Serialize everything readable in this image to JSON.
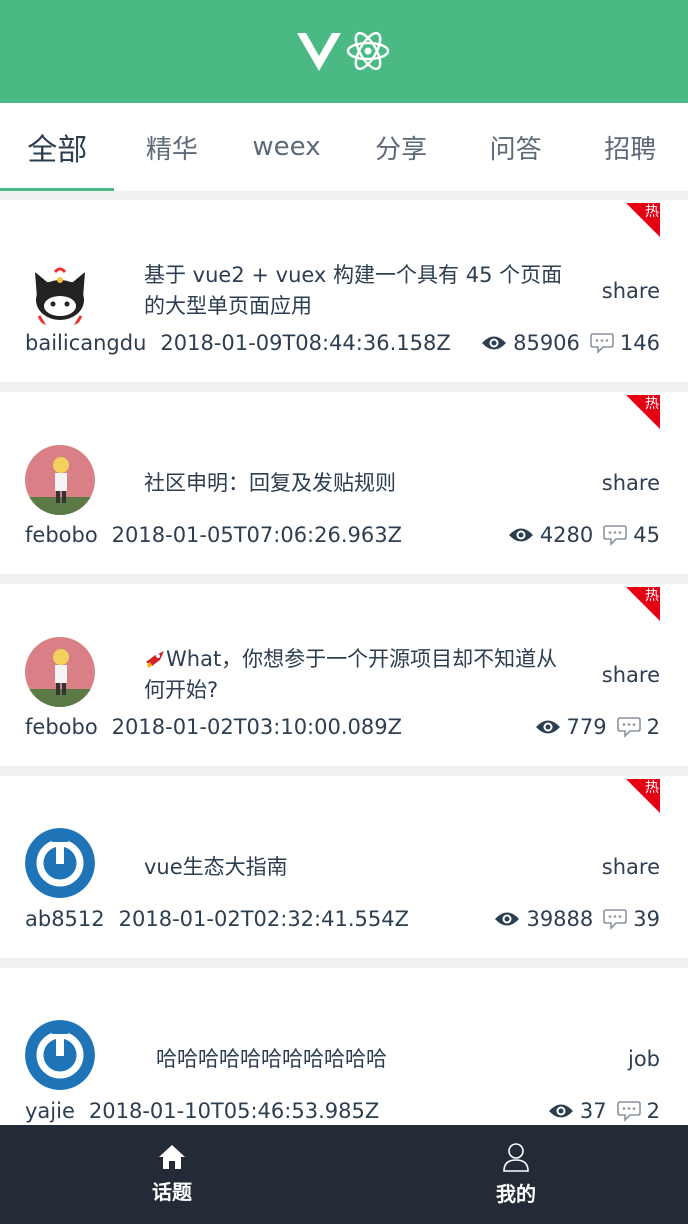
{
  "tabs": [
    "全部",
    "精华",
    "weex",
    "分享",
    "问答",
    "招聘"
  ],
  "hot_label": "热",
  "topics": [
    {
      "author": "bailicangdu",
      "date": "2018-01-09T08:44:36.158Z",
      "title": "基于 vue2 + vuex 构建一个具有 45 个页面的大型单页面应用",
      "tag": "share",
      "views": "85906",
      "replies": "146",
      "avatar": "cat-avatar"
    },
    {
      "author": "febobo",
      "date": "2018-01-05T07:06:26.963Z",
      "title": "社区申明：回复及发贴规则",
      "tag": "share",
      "views": "4280",
      "replies": "45",
      "avatar": "photo-avatar"
    },
    {
      "author": "febobo",
      "date": "2018-01-02T03:10:00.089Z",
      "title": "What，你想参于一个开源项目却不知道从何开始?",
      "tag": "share",
      "views": "779",
      "replies": "2",
      "avatar": "photo-avatar"
    },
    {
      "author": "ab8512",
      "date": "2018-01-02T02:32:41.554Z",
      "title": "vue生态大指南",
      "tag": "share",
      "views": "39888",
      "replies": "39",
      "avatar": "power-avatar"
    },
    {
      "author": "yajie",
      "date": "2018-01-10T05:46:53.985Z",
      "title": "哈哈哈哈哈哈哈哈哈哈哈",
      "tag": "job",
      "views": "37",
      "replies": "2",
      "avatar": "power-avatar"
    }
  ],
  "footer": {
    "topics_label": "话题",
    "mine_label": "我的"
  },
  "colors": {
    "brand": "#4bb983",
    "footer_bg": "#222b36",
    "hot": "#e60012"
  }
}
